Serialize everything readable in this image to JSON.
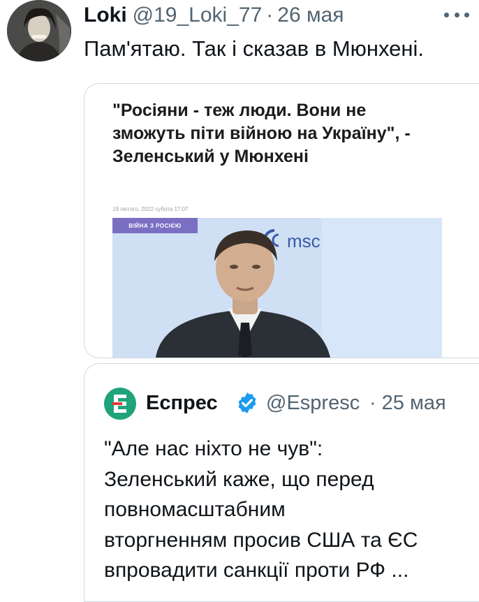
{
  "tweet": {
    "display_name": "Loki",
    "handle": "@19_Loki_77",
    "separator": "·",
    "date": "26 мая",
    "text": "Пам'ятаю. Так і сказав в Мюнхені.",
    "more_icon": "more-dots-icon"
  },
  "media": {
    "headline": "\"Росіяни - теж люди. Вони не зможуть піти війною на Україну\", - Зеленський у Мюнхені",
    "date_text": "19 лютого, 2022 субота 17:07",
    "category_tag": "ВІЙНА З РОСІЄЮ",
    "backdrop_logo": "msc",
    "colors": {
      "backdrop": "#cfe0f5",
      "tag": "#7b6fc4",
      "logo": "#3b5aa8"
    }
  },
  "quote": {
    "name": "Еспрес",
    "verified_icon": "verified-badge-icon",
    "handle": "@Espresc",
    "separator": "·",
    "date": "25 мая",
    "text_lines": [
      "\"Але нас ніхто не чув\":",
      "Зеленський каже, що перед",
      "повномасштабним",
      "вторгненням просив США та ЄС",
      "впровадити санкції проти РФ ..."
    ],
    "avatar_colors": {
      "bg": "#1fa37b",
      "accent": "#e53935"
    }
  },
  "colors": {
    "text_primary": "#0f1419",
    "text_secondary": "#536471",
    "border": "#cfd9de",
    "verified": "#1d9bf0"
  }
}
